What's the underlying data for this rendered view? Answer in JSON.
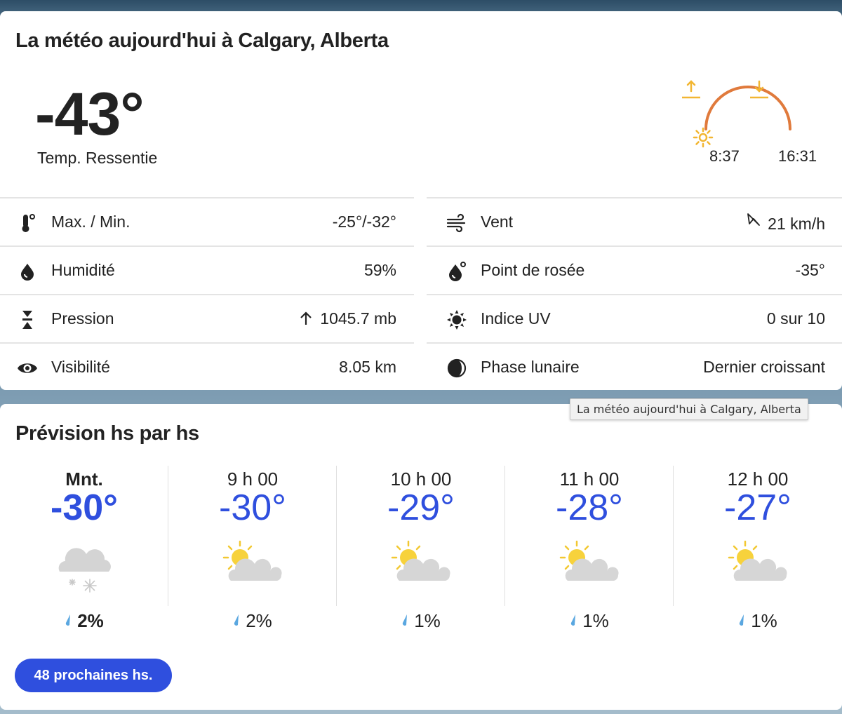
{
  "today": {
    "title": "La météo aujourd'hui à Calgary, Alberta",
    "feels_like": "-43°",
    "feels_like_label": "Temp. Ressentie",
    "sunrise": "8:37",
    "sunset": "16:31",
    "left_details": [
      {
        "icon": "thermometer-icon",
        "label": "Max. / Min.",
        "value": "-25°/-32°"
      },
      {
        "icon": "humidity-drop-icon",
        "label": "Humidité",
        "value": "59%"
      },
      {
        "icon": "pressure-icon",
        "label": "Pression",
        "value": "1045.7 mb"
      },
      {
        "icon": "eye-icon",
        "label": "Visibilité",
        "value": "8.05 km"
      }
    ],
    "right_details": [
      {
        "icon": "wind-icon",
        "label": "Vent",
        "value": "21 km/h"
      },
      {
        "icon": "dew-point-icon",
        "label": "Point de rosée",
        "value": "-35°"
      },
      {
        "icon": "uv-sun-icon",
        "label": "Indice UV",
        "value": "0 sur 10"
      },
      {
        "icon": "moon-phase-icon",
        "label": "Phase lunaire",
        "value": "Dernier croissant"
      }
    ]
  },
  "tooltip": "La météo aujourd'hui à Calgary, Alberta",
  "hourly": {
    "title": "Prévision hs par hs",
    "hours": [
      {
        "time": "Mnt.",
        "temp": "-30°",
        "precip": "2%",
        "icon": "cloud-snow-icon"
      },
      {
        "time": "9 h 00",
        "temp": "-30°",
        "precip": "2%",
        "icon": "partly-cloudy-icon"
      },
      {
        "time": "10 h 00",
        "temp": "-29°",
        "precip": "1%",
        "icon": "partly-cloudy-icon"
      },
      {
        "time": "11 h 00",
        "temp": "-28°",
        "precip": "1%",
        "icon": "partly-cloudy-icon"
      },
      {
        "time": "12 h 00",
        "temp": "-27°",
        "precip": "1%",
        "icon": "partly-cloudy-icon"
      }
    ],
    "more_button": "48 prochaines hs."
  },
  "colors": {
    "accent": "#2f4fde",
    "sun_arc": "#e07a3c",
    "sun": "#f2b632",
    "rain_drop": "#5aa7e0"
  }
}
